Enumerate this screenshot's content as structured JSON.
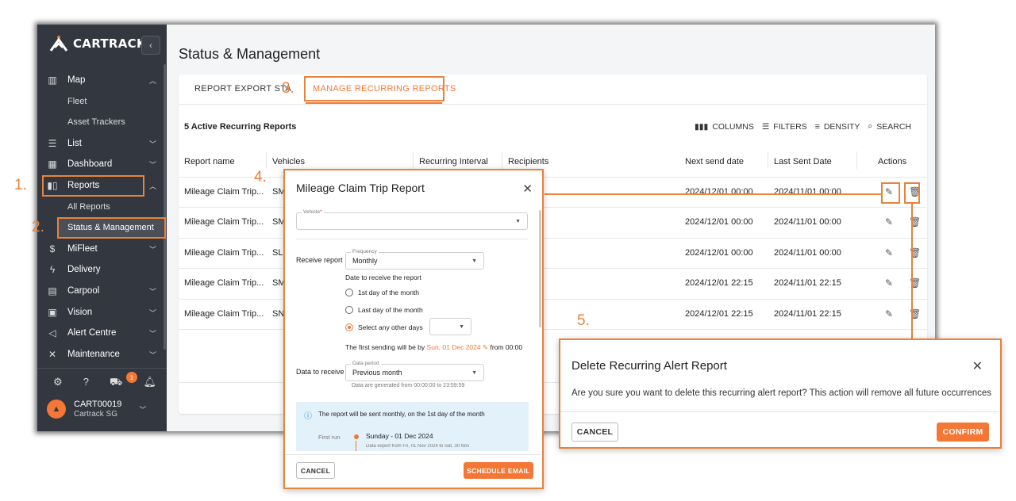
{
  "sidebar": {
    "brand": "CARTRACK",
    "collapse_icon": "‹",
    "items": [
      {
        "label": "Map",
        "icon": "map-icon"
      },
      {
        "label": "Fleet"
      },
      {
        "label": "Asset Trackers"
      },
      {
        "label": "List",
        "icon": "list-icon"
      },
      {
        "label": "Dashboard",
        "icon": "dashboard-icon"
      },
      {
        "label": "Reports",
        "icon": "reports-icon"
      },
      {
        "label": "All Reports"
      },
      {
        "label": "Status & Management"
      },
      {
        "label": "MiFleet",
        "icon": "dollar-icon"
      },
      {
        "label": "Delivery",
        "icon": "delivery-icon"
      },
      {
        "label": "Carpool",
        "icon": "calendar-icon"
      },
      {
        "label": "Vision",
        "icon": "camera-icon"
      },
      {
        "label": "Alert Centre",
        "icon": "megaphone-icon"
      },
      {
        "label": "Maintenance",
        "icon": "wrench-icon"
      }
    ],
    "notification_count": "1",
    "user": {
      "name": "CART00019",
      "org": "Cartrack SG"
    }
  },
  "main": {
    "title": "Status & Management",
    "tabs": [
      {
        "label": "REPORT EXPORT STA"
      },
      {
        "label": "MANAGE RECURRING REPORTS"
      }
    ],
    "count_label": "5 Active Recurring Reports",
    "toolbar": {
      "columns": "COLUMNS",
      "filters": "FILTERS",
      "density": "DENSITY",
      "search": "SEARCH"
    },
    "columns": [
      "Report name",
      "Vehicles",
      "Recurring Interval",
      "Recipients",
      "Next send date",
      "Last Sent Date",
      "Actions"
    ],
    "rows": [
      {
        "name": "Mileage Claim Trip...",
        "vehicles": "SM",
        "next": "2024/12/01 00:00",
        "last": "2024/11/01 00:00"
      },
      {
        "name": "Mileage Claim Trip...",
        "vehicles": "SM",
        "next": "2024/12/01 00:00",
        "last": "2024/11/01 00:00"
      },
      {
        "name": "Mileage Claim Trip...",
        "vehicles": "SL",
        "next": "2024/12/01 00:00",
        "last": "2024/11/01 00:00"
      },
      {
        "name": "Mileage Claim Trip...",
        "vehicles": "SM",
        "next": "2024/12/01 22:15",
        "last": "2024/11/01 22:15"
      },
      {
        "name": "Mileage Claim Trip...",
        "vehicles": "SN",
        "next": "2024/12/01 22:15",
        "last": "2024/11/01 22:15"
      }
    ]
  },
  "schedule_modal": {
    "title": "Mileage Claim Trip Report",
    "vehicle_label": "Vehicle",
    "required_mark": "*",
    "receive_report_label": "Receive report",
    "frequency_label": "Frequency",
    "frequency_value": "Monthly",
    "date_to_receive_label": "Date to receive the report",
    "options": [
      "1st day of the month",
      "Last day of the month",
      "Select any other days"
    ],
    "first_sending_prefix": "The first sending will be by",
    "first_sending_date": "Sun, 01 Dec 2024",
    "first_sending_suffix": "from 00:00",
    "data_to_receive_label": "Data to receive",
    "data_period_label": "Data period",
    "data_period_value": "Previous month",
    "data_generated_note": "Data are generated from 00:00:00 to 23:59:59",
    "info_text": "The report will be sent monthly, on the 1st day of the month",
    "first_run_label": "First run",
    "first_run_value": "Sunday - 01 Dec 2024",
    "first_run_detail": "Data export from Fri, 01 Nov 2024 to Sat, 30 Nov",
    "cancel": "CANCEL",
    "submit": "SCHEDULE EMAIL"
  },
  "delete_modal": {
    "title": "Delete Recurring Alert Report",
    "body": "Are you sure you want to delete this recurring alert report? This action will remove all future occurrences",
    "cancel": "CANCEL",
    "confirm": "CONFIRM"
  },
  "annotations": {
    "s1": "1.",
    "s2": "2.",
    "s3": "3.",
    "s4": "4.",
    "s5": "5."
  },
  "colors": {
    "accent": "#f47735",
    "annotation": "#e9823a",
    "sidebar": "#333740"
  }
}
